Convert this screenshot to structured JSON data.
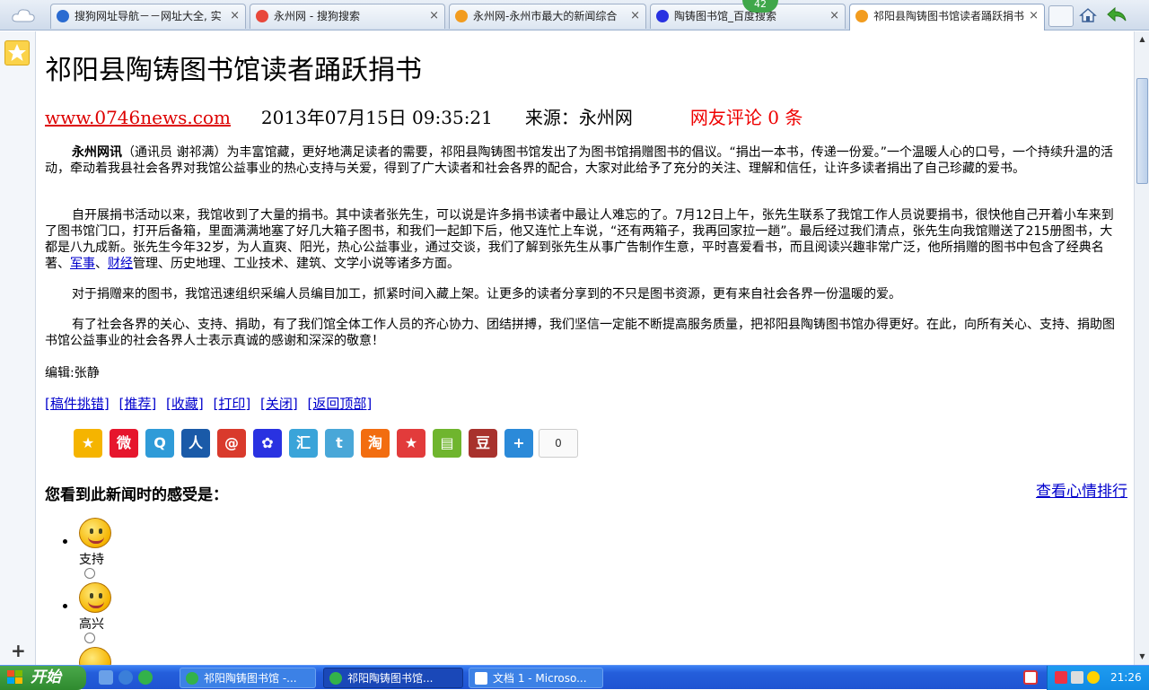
{
  "browser": {
    "tabs": [
      {
        "title": "搜狗网址导航－－网址大全, 实"
      },
      {
        "title": "永州网 - 搜狗搜索"
      },
      {
        "title": "永州网-永州市最大的新闻综合"
      },
      {
        "title": "陶铸图书馆_百度搜索"
      },
      {
        "title": "祁阳县陶铸图书馆读者踊跃捐书"
      }
    ],
    "badge": "42",
    "close_glyph": "×"
  },
  "article": {
    "title": "祁阳县陶铸图书馆读者踊跃捐书",
    "site": "www.0746news.com",
    "date": "2013年07月15日 09:35:21",
    "source": "来源：永州网",
    "comments": "网友评论 0 条",
    "p1_lead": "永州网讯",
    "p1_body": "（通讯员 谢祁满）为丰富馆藏，更好地满足读者的需要，祁阳县陶铸图书馆发出了为图书馆捐赠图书的倡议。“捐出一本书，传递一份爱。”一个温暖人心的口号，一个持续升温的活动，牵动着我县社会各界对我馆公益事业的热心支持与关爱，得到了广大读者和社会各界的配合，大家对此给予了充分的关注、理解和信任，让许多读者捐出了自己珍藏的爱书。",
    "p2_a": "自开展捐书活动以来，我馆收到了大量的捐书。其中读者张先生，可以说是许多捐书读者中最让人难忘的了。7月12日上午，张先生联系了我馆工作人员说要捐书，很快他自己开着小车来到了图书馆门口，打开后备箱，里面满满地塞了好几大箱子图书，和我们一起卸下后，他又连忙上车说，“还有两箱子，我再回家拉一趟”。最后经过我们清点，张先生向我馆赠送了215册图书，大都是八九成新。张先生今年32岁，为人直爽、阳光，热心公益事业，通过交谈，我们了解到张先生从事广告制作生意，平时喜爱看书，而且阅读兴趣非常广泛，他所捐赠的图书中包含了经典名著、",
    "p2_link1": "军事",
    "p2_sep": "、",
    "p2_link2": "财经",
    "p2_b": "管理、历史地理、工业技术、建筑、文学小说等诸多方面。",
    "p3": "对于捐赠来的图书，我馆迅速组织采编人员编目加工，抓紧时间入藏上架。让更多的读者分享到的不只是图书资源，更有来自社会各界一份温暖的爱。",
    "p4": "有了社会各界的关心、支持、捐助，有了我们馆全体工作人员的齐心协力、团结拼搏，我们坚信一定能不断提高服务质量，把祁阳县陶铸图书馆办得更好。在此，向所有关心、支持、捐助图书馆公益事业的社会各界人士表示真诚的感谢和深深的敬意！",
    "editor": "编辑:张静",
    "actions": [
      "[稿件挑错]",
      "[推荐]",
      "[收藏]",
      "[打印]",
      "[关闭]",
      "[返回顶部]"
    ]
  },
  "share": {
    "icons": [
      {
        "name": "qzone-icon",
        "glyph": "★",
        "color": "#f5b400"
      },
      {
        "name": "sina-weibo-icon",
        "glyph": "微",
        "color": "#e6162d"
      },
      {
        "name": "tencent-weibo-icon",
        "glyph": "Q",
        "color": "#2f9bd8"
      },
      {
        "name": "renren-icon",
        "glyph": "人",
        "color": "#1a5aa8"
      },
      {
        "name": "netease-icon",
        "glyph": "@",
        "color": "#d93a2c"
      },
      {
        "name": "baidu-icon",
        "glyph": "✿",
        "color": "#2932e1"
      },
      {
        "name": "kaixin-icon",
        "glyph": "汇",
        "color": "#3aa4d9"
      },
      {
        "name": "twitter-icon",
        "glyph": "t",
        "color": "#49a7d8"
      },
      {
        "name": "taobao-icon",
        "glyph": "淘",
        "color": "#f26d10"
      },
      {
        "name": "favorites-star-icon",
        "glyph": "★",
        "color": "#e23b3b"
      },
      {
        "name": "bookmark-icon",
        "glyph": "▤",
        "color": "#6fb52e"
      },
      {
        "name": "douban-icon",
        "glyph": "豆",
        "color": "#a8322d"
      },
      {
        "name": "more-share-icon",
        "glyph": "+",
        "color": "#2b8ad9"
      }
    ],
    "count": "0"
  },
  "mood": {
    "heading": "您看到此新闻时的感受是：",
    "rank_link": "查看心情排行",
    "items": [
      {
        "label": "支持"
      },
      {
        "label": "高兴"
      }
    ]
  },
  "taskbar": {
    "start": "开始",
    "buttons": [
      {
        "label": "祁阳陶铸图书馆 -..."
      },
      {
        "label": "祁阳陶铸图书馆..."
      },
      {
        "label": "文档 1 - Microso..."
      }
    ],
    "clock": "21:26"
  }
}
